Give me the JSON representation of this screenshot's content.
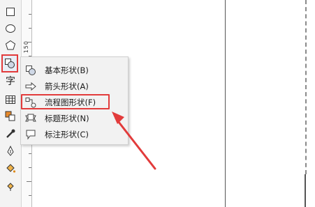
{
  "toolbox": {
    "tools": [
      {
        "name": "rectangle-tool",
        "icon": "rectangle-icon"
      },
      {
        "name": "ellipse-tool",
        "icon": "ellipse-icon"
      },
      {
        "name": "polygon-tool",
        "icon": "polygon-icon"
      },
      {
        "name": "basic-shapes-tool",
        "icon": "basic-shapes-icon",
        "active": true
      },
      {
        "name": "text-tool",
        "icon": "text-icon",
        "glyph": "字"
      },
      {
        "name": "table-tool",
        "icon": "table-icon"
      },
      {
        "name": "interactive-tool",
        "icon": "interactive-icon"
      },
      {
        "name": "eyedropper-tool",
        "icon": "eyedropper-icon"
      },
      {
        "name": "outline-pen-tool",
        "icon": "pen-nib-icon"
      },
      {
        "name": "fill-tool",
        "icon": "paint-bucket-icon"
      },
      {
        "name": "smart-fill-tool",
        "icon": "smart-fill-icon"
      }
    ]
  },
  "ruler": {
    "label": "150"
  },
  "menu": {
    "items": [
      {
        "label": "基本形状(B)",
        "icon": "basic-shapes-icon"
      },
      {
        "label": "箭头形状(A)",
        "icon": "arrow-shapes-icon"
      },
      {
        "label": "流程图形状(F)",
        "icon": "flowchart-shapes-icon",
        "highlighted": true
      },
      {
        "label": "标题形状(N)",
        "icon": "banner-shapes-icon"
      },
      {
        "label": "标注形状(C)",
        "icon": "callout-shapes-icon"
      }
    ]
  },
  "colors": {
    "highlight": "#e23b3b",
    "menu_bg": "#f2f2f2"
  }
}
